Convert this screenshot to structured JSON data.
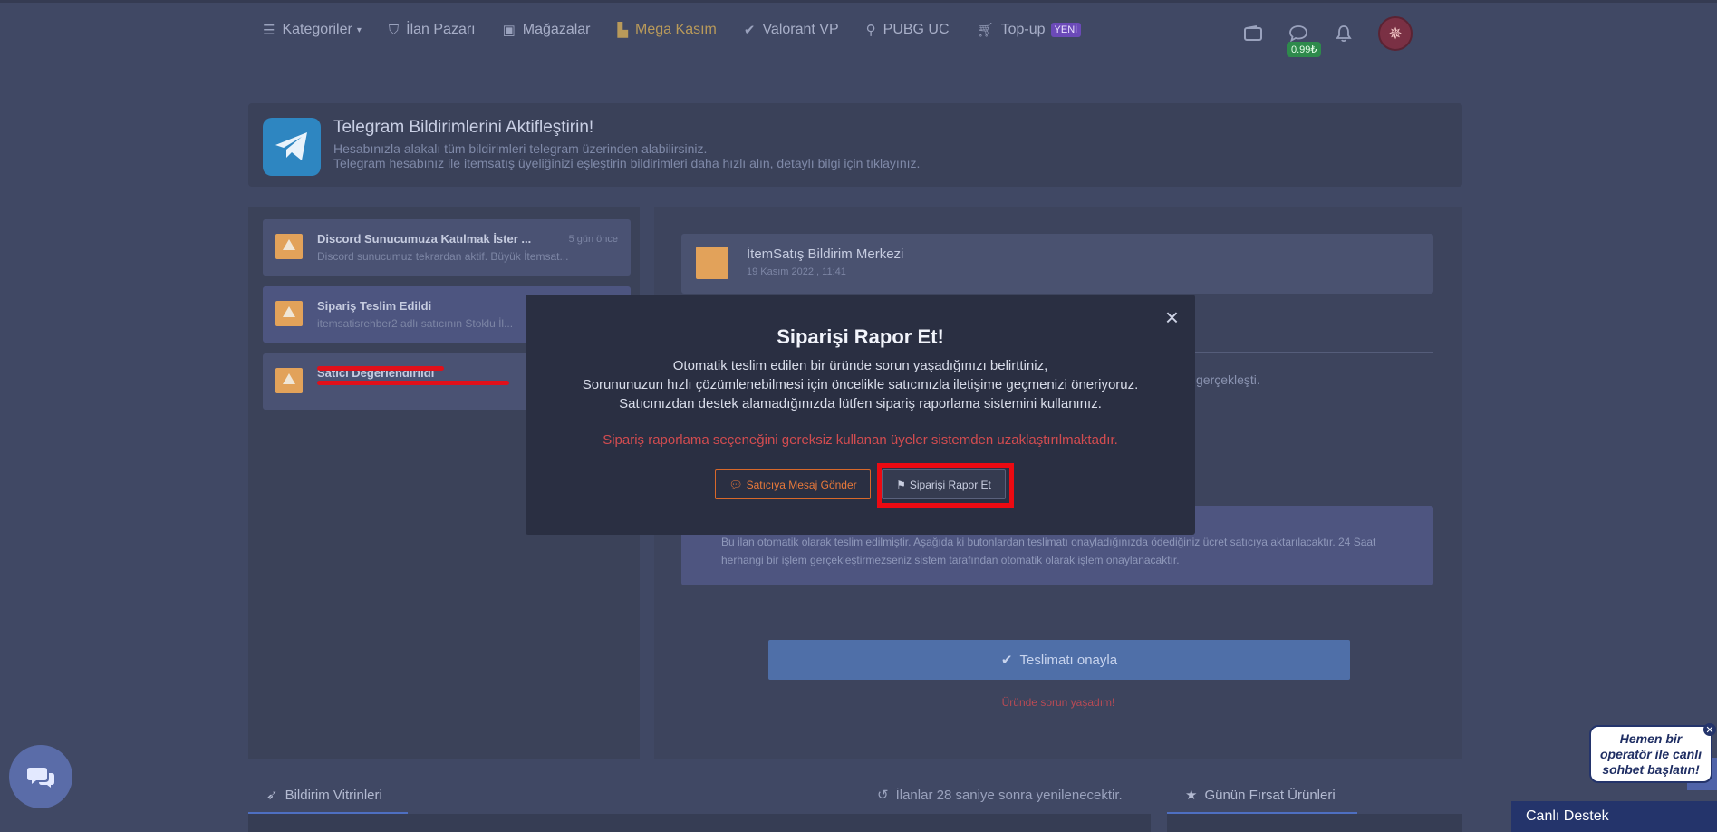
{
  "nav": {
    "items": [
      {
        "label": "Kategoriler",
        "icon": "list-icon"
      },
      {
        "label": "İlan Pazarı",
        "icon": "basket-icon"
      },
      {
        "label": "Mağazalar",
        "icon": "store-icon"
      },
      {
        "label": "Mega Kasım",
        "icon": "building-icon"
      },
      {
        "label": "Valorant VP",
        "icon": "valorant-icon"
      },
      {
        "label": "PUBG UC",
        "icon": "pubg-icon"
      },
      {
        "label": "Top-up",
        "icon": "cart-icon"
      }
    ],
    "new_badge": "YENİ",
    "wallet_amount": "0.99₺"
  },
  "telegram": {
    "title": "Telegram Bildirimlerini Aktifleştirin!",
    "line1": "Hesabınızla alakalı tüm bildirimleri telegram üzerinden alabilirsiniz.",
    "line2": "Telegram hesabınız ile itemsatış üyeliğinizi eşleştirin bildirimleri daha hızlı alın, detaylı bilgi için tıklayınız."
  },
  "notifications": [
    {
      "title": "Discord Sunucumuza Katılmak İster ...",
      "desc": "Discord sunucumuz tekrardan aktif. Büyük İtemsat...",
      "time": "5 gün önce"
    },
    {
      "title": "Sipariş Teslim Edildi",
      "desc": "itemsatisrehber2 adlı satıcının Stoklu İl...",
      "time": ""
    },
    {
      "title": "Satıcı Değerlendirildi",
      "desc": "",
      "time": ""
    }
  ],
  "message": {
    "title": "İtemSatış Bildirim Merkezi",
    "date": "19 Kasım 2022 , 11:41",
    "partial_text": "gerçekleşti.",
    "info": "Bu ilan otomatik olarak teslim edilmiştir. Aşağıda ki butonlardan teslimatı onayladığınızda ödediğiniz ücret satıcıya aktarılacaktır. 24 Saat herhangi bir işlem gerçekleştirmezseniz sistem tarafından otomatik olarak işlem onaylanacaktır.",
    "confirm_label": "Teslimatı onayla",
    "problem_label": "Üründe sorun yaşadım!"
  },
  "bottom": {
    "tab1": "Bildirim Vitrinleri",
    "refresh": "İlanlar 28 saniye sonra yenilenecektir.",
    "tab2": "Günün Fırsat Ürünleri"
  },
  "modal": {
    "title": "Siparişi Rapor Et!",
    "line1": "Otomatik teslim edilen bir üründe sorun yaşadığınızı belirttiniz,",
    "line2": "Sorununuzun hızlı çözümlenebilmesi için öncelikle satıcınızla iletişime geçmenizi öneriyoruz.",
    "line3": "Satıcınızdan destek alamadığınızda lütfen sipariş raporlama sistemini kullanınız.",
    "warning": "Sipariş raporlama seçeneğini gereksiz kullanan üyeler sistemden uzaklaştırılmaktadır.",
    "send_message_label": "Satıcıya Mesaj Gönder",
    "report_label": "Siparişi Rapor Et",
    "close_glyph": "×"
  },
  "support": {
    "operator_text": "Hemen bir operatör ile canlı sohbet başlatın!",
    "close_glyph": "✕",
    "live_label": "Canlı Destek"
  }
}
